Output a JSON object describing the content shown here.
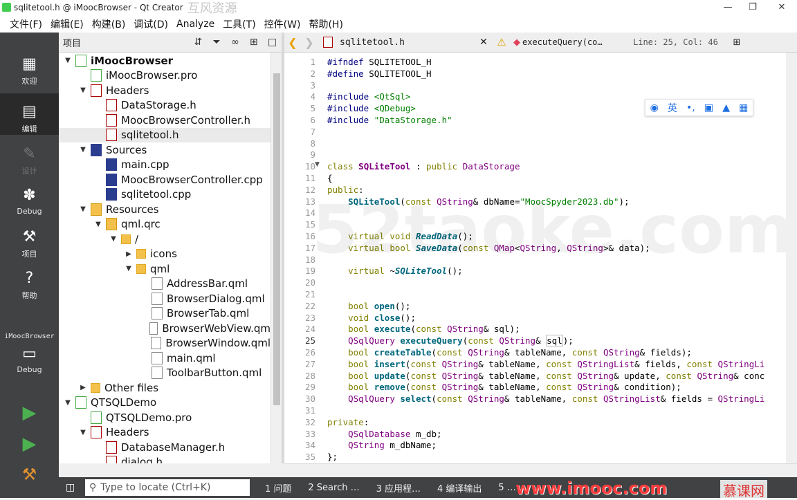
{
  "window": {
    "title": "sqlitetool.h @ iMoocBrowser - Qt Creator",
    "watermark_top": "互风资源"
  },
  "menu": [
    "文件(F)",
    "编辑(E)",
    "构建(B)",
    "调试(D)",
    "Analyze",
    "工具(T)",
    "控件(W)",
    "帮助(H)"
  ],
  "modes": [
    {
      "label": "欢迎",
      "icon": "welcome-icon"
    },
    {
      "label": "编辑",
      "icon": "edit-icon"
    },
    {
      "label": "设计",
      "icon": "design-icon"
    },
    {
      "label": "Debug",
      "icon": "debug-icon"
    },
    {
      "label": "项目",
      "icon": "projects-icon"
    },
    {
      "label": "帮助",
      "icon": "help-icon"
    }
  ],
  "kit": {
    "project": "iMoocBrowser",
    "mode": "Debug"
  },
  "project_panel": {
    "title": "项目"
  },
  "tree": [
    {
      "depth": 0,
      "arrow": "▼",
      "icon": "pro",
      "label": "iMoocBrowser",
      "bold": true
    },
    {
      "depth": 1,
      "arrow": "",
      "icon": "pro",
      "label": "iMoocBrowser.pro"
    },
    {
      "depth": 1,
      "arrow": "▼",
      "icon": "h",
      "label": "Headers"
    },
    {
      "depth": 2,
      "arrow": "",
      "icon": "h",
      "label": "DataStorage.h"
    },
    {
      "depth": 2,
      "arrow": "",
      "icon": "h",
      "label": "MoocBrowserController.h"
    },
    {
      "depth": 2,
      "arrow": "",
      "icon": "h",
      "label": "sqlitetool.h",
      "selected": true
    },
    {
      "depth": 1,
      "arrow": "▼",
      "icon": "cpp",
      "label": "Sources"
    },
    {
      "depth": 2,
      "arrow": "",
      "icon": "cpp",
      "label": "main.cpp"
    },
    {
      "depth": 2,
      "arrow": "",
      "icon": "cpp",
      "label": "MoocBrowserController.cpp"
    },
    {
      "depth": 2,
      "arrow": "",
      "icon": "cpp",
      "label": "sqlitetool.cpp"
    },
    {
      "depth": 1,
      "arrow": "▼",
      "icon": "qrc",
      "label": "Resources"
    },
    {
      "depth": 2,
      "arrow": "▼",
      "icon": "qrc",
      "label": "qml.qrc"
    },
    {
      "depth": 3,
      "arrow": "▼",
      "icon": "folder",
      "label": "/"
    },
    {
      "depth": 4,
      "arrow": "▶",
      "icon": "folder",
      "label": "icons"
    },
    {
      "depth": 4,
      "arrow": "▼",
      "icon": "folder",
      "label": "qml"
    },
    {
      "depth": 5,
      "arrow": "",
      "icon": "qml",
      "label": "AddressBar.qml"
    },
    {
      "depth": 5,
      "arrow": "",
      "icon": "qml",
      "label": "BrowserDialog.qml"
    },
    {
      "depth": 5,
      "arrow": "",
      "icon": "qml",
      "label": "BrowserTab.qml"
    },
    {
      "depth": 5,
      "arrow": "",
      "icon": "qml",
      "label": "BrowserWebView.qm"
    },
    {
      "depth": 5,
      "arrow": "",
      "icon": "qml",
      "label": "BrowserWindow.qml"
    },
    {
      "depth": 5,
      "arrow": "",
      "icon": "qml",
      "label": "main.qml"
    },
    {
      "depth": 5,
      "arrow": "",
      "icon": "qml",
      "label": "ToolbarButton.qml"
    },
    {
      "depth": 1,
      "arrow": "▶",
      "icon": "folder",
      "label": "Other files"
    },
    {
      "depth": 0,
      "arrow": "▼",
      "icon": "pro",
      "label": "QTSQLDemo"
    },
    {
      "depth": 1,
      "arrow": "",
      "icon": "pro",
      "label": "QTSQLDemo.pro"
    },
    {
      "depth": 1,
      "arrow": "▼",
      "icon": "h",
      "label": "Headers"
    },
    {
      "depth": 2,
      "arrow": "",
      "icon": "h",
      "label": "DatabaseManager.h"
    },
    {
      "depth": 2,
      "arrow": "",
      "icon": "h",
      "label": "dialog.h"
    }
  ],
  "editor_header": {
    "file": "sqlitetool.h",
    "symbol": "executeQuery(co…",
    "position": "Line: 25, Col: 46"
  },
  "code": [
    {
      "n": "1",
      "html": "<span class=\"pp\">#ifndef</span> SQLITETOOL_H"
    },
    {
      "n": "2",
      "html": "<span class=\"pp\">#define</span> SQLITETOOL_H"
    },
    {
      "n": "3",
      "html": ""
    },
    {
      "n": "4",
      "html": "<span class=\"pp\">#include</span> <span class=\"st\">&lt;QtSql&gt;</span>"
    },
    {
      "n": "5",
      "html": "<span class=\"pp\">#include</span> <span class=\"st\">&lt;QDebug&gt;</span>"
    },
    {
      "n": "6",
      "html": "<span class=\"pp\">#include</span> <span class=\"st\">\"DataStorage.h\"</span>"
    },
    {
      "n": "7",
      "html": ""
    },
    {
      "n": "8",
      "html": ""
    },
    {
      "n": "9",
      "html": ""
    },
    {
      "n": "10",
      "html": "<span class=\"kw\">class</span> <span class=\"ty bd\">SQLiteTool</span> : <span class=\"kw\">public</span> <span class=\"ty\">DataStorage</span>"
    },
    {
      "n": "11",
      "html": "{"
    },
    {
      "n": "12",
      "html": "<span class=\"kw\">public</span>:"
    },
    {
      "n": "13",
      "html": "    <span class=\"fn bd\">SQLiteTool</span>(<span class=\"kw\">const</span> <span class=\"ty\">QString</span>&amp; dbName=<span class=\"st\">\"MoocSpyder2023.db\"</span>);"
    },
    {
      "n": "14",
      "html": ""
    },
    {
      "n": "15",
      "html": ""
    },
    {
      "n": "16",
      "html": "    <span class=\"kw\">virtual</span> <span class=\"kw\">void</span> <span class=\"fi\">ReadData</span>();"
    },
    {
      "n": "17",
      "html": "    <span class=\"kw\">virtual</span> <span class=\"kw\">bool</span> <span class=\"fi\">SaveData</span>(<span class=\"kw\">const</span> <span class=\"ty\">QMap</span>&lt;<span class=\"ty\">QString</span>, <span class=\"ty\">QString</span>&gt;&amp; data);"
    },
    {
      "n": "18",
      "html": ""
    },
    {
      "n": "19",
      "html": "    <span class=\"kw\">virtual</span> ~<span class=\"fi\">SQLiteTool</span>();"
    },
    {
      "n": "20",
      "html": ""
    },
    {
      "n": "21",
      "html": ""
    },
    {
      "n": "22",
      "html": "    <span class=\"kw\">bool</span> <span class=\"fn bd\">open</span>();"
    },
    {
      "n": "23",
      "html": "    <span class=\"kw\">void</span> <span class=\"fn bd\">close</span>();"
    },
    {
      "n": "24",
      "html": "    <span class=\"kw\">bool</span> <span class=\"fn bd\">execute</span>(<span class=\"kw\">const</span> <span class=\"ty\">QString</span>&amp; sql);"
    },
    {
      "n": "25",
      "html": "    <span class=\"ty\">QSqlQuery</span> <span class=\"fn bd\">executeQuery</span>(<span class=\"kw\">const</span> <span class=\"ty\">QString</span>&amp; <span style=\"border:1px solid #bbb\">sql</span>);"
    },
    {
      "n": "26",
      "html": "    <span class=\"kw\">bool</span> <span class=\"fn bd\">createTable</span>(<span class=\"kw\">const</span> <span class=\"ty\">QString</span>&amp; tableName, <span class=\"kw\">const</span> <span class=\"ty\">QString</span>&amp; fields);"
    },
    {
      "n": "27",
      "html": "    <span class=\"kw\">bool</span> <span class=\"fn bd\">insert</span>(<span class=\"kw\">const</span> <span class=\"ty\">QString</span>&amp; tableName, <span class=\"kw\">const</span> <span class=\"ty\">QStringList</span>&amp; fields, <span class=\"kw\">const</span> <span class=\"ty\">QStringLi</span>"
    },
    {
      "n": "28",
      "html": "    <span class=\"kw\">bool</span> <span class=\"fn bd\">update</span>(<span class=\"kw\">const</span> <span class=\"ty\">QString</span>&amp; tableName, <span class=\"kw\">const</span> <span class=\"ty\">QString</span>&amp; update, <span class=\"kw\">const</span> <span class=\"ty\">QString</span>&amp; conc"
    },
    {
      "n": "29",
      "html": "    <span class=\"kw\">bool</span> <span class=\"fn bd\">remove</span>(<span class=\"kw\">const</span> <span class=\"ty\">QString</span>&amp; tableName, <span class=\"kw\">const</span> <span class=\"ty\">QString</span>&amp; condition);"
    },
    {
      "n": "30",
      "html": "    <span class=\"ty\">QSqlQuery</span> <span class=\"fn bd\">select</span>(<span class=\"kw\">const</span> <span class=\"ty\">QString</span>&amp; tableName, <span class=\"kw\">const</span> <span class=\"ty\">QStringList</span>&amp; fields = <span class=\"ty\">QStringLi</span>"
    },
    {
      "n": "31",
      "html": ""
    },
    {
      "n": "32",
      "html": "<span class=\"kw\">private</span>:"
    },
    {
      "n": "33",
      "html": "    <span class=\"ty\">QSqlDatabase</span> m_db;"
    },
    {
      "n": "34",
      "html": "    <span class=\"ty\">QString</span> m_dbName;"
    },
    {
      "n": "35",
      "html": "};"
    }
  ],
  "current_line": "25",
  "locator": {
    "placeholder": "Type to locate (Ctrl+K)"
  },
  "output_tabs": [
    "1 问题",
    "2 Search …",
    "3 应用程…",
    "4 编译输出",
    "5 …"
  ],
  "brand": {
    "site": "www.imooc.com",
    "logo": "慕课网"
  },
  "watermark": "52taoke.com",
  "colors": {
    "sidebar": "#404244",
    "keyword": "#808000",
    "type": "#800080",
    "string": "#008000",
    "function": "#00677c"
  }
}
